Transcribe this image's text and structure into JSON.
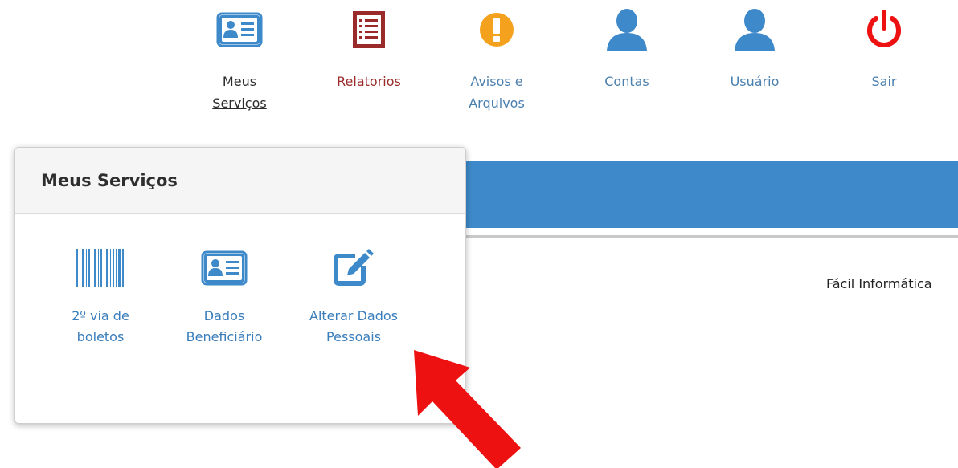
{
  "topnav": {
    "items": [
      {
        "label": "Meus\nServiços",
        "icon": "id-card-icon",
        "active": true
      },
      {
        "label": "Relatorios",
        "icon": "report-list-icon",
        "active": false
      },
      {
        "label": "Avisos e\nArquivos",
        "icon": "warning-icon",
        "active": false
      },
      {
        "label": "Contas",
        "icon": "user-icon",
        "active": false
      },
      {
        "label": "Usuário",
        "icon": "user-icon",
        "active": false
      },
      {
        "label": "Sair",
        "icon": "power-icon",
        "active": false
      }
    ]
  },
  "panel": {
    "title": "Meus Serviços",
    "services": [
      {
        "label": "2º via de\nboletos",
        "icon": "barcode-icon"
      },
      {
        "label": "Dados\nBeneficiário",
        "icon": "id-card-icon"
      },
      {
        "label": "Alterar Dados\nPessoais",
        "icon": "edit-icon"
      }
    ]
  },
  "footer": {
    "company": "Fácil Informática"
  },
  "colors": {
    "primary_blue": "#3d89c9",
    "link_blue": "#3a7dbb",
    "report_red": "#9b2b2b",
    "warning_orange": "#f4a21d",
    "power_red": "#ee1111",
    "arrow_red": "#ee1111"
  }
}
